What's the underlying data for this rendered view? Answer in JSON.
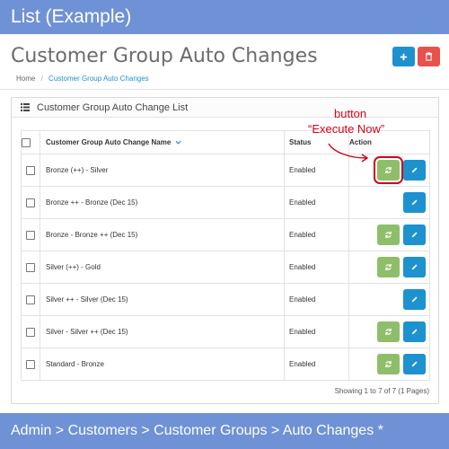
{
  "banner": {
    "top": "List (Example)",
    "bottom": "Admin > Customers > Customer Groups > Auto Changes *"
  },
  "page": {
    "title": "Customer Group Auto Changes"
  },
  "breadcrumb": {
    "home": "Home",
    "separator": "/",
    "current": "Customer Group Auto Changes"
  },
  "panel": {
    "title": "Customer Group Auto Change List"
  },
  "table": {
    "headers": {
      "name": "Customer Group Auto Change Name",
      "status": "Status",
      "action": "Action"
    },
    "rows": [
      {
        "name": "Bronze (++) - Silver",
        "status": "Enabled",
        "execute": true
      },
      {
        "name": "Bronze ++ - Bronze (Dec 15)",
        "status": "Enabled",
        "execute": false
      },
      {
        "name": "Bronze - Bronze ++ (Dec 15)",
        "status": "Enabled",
        "execute": true
      },
      {
        "name": "Silver (++) - Gold",
        "status": "Enabled",
        "execute": true
      },
      {
        "name": "Silver ++ - Silver (Dec 15)",
        "status": "Enabled",
        "execute": false
      },
      {
        "name": "Silver - Silver ++ (Dec 15)",
        "status": "Enabled",
        "execute": true
      },
      {
        "name": "Standard - Bronze",
        "status": "Enabled",
        "execute": true
      }
    ]
  },
  "pagination": {
    "text": "Showing 1 to 7 of 7 (1 Pages)"
  },
  "annotation": {
    "line1": "button",
    "line2": "“Execute Now”"
  },
  "colors": {
    "banner": "#6f92d6",
    "primary": "#1e91cf",
    "danger": "#e8514c",
    "success": "#8fbe6a",
    "annotation": "#d0021b"
  },
  "icons": {
    "add": "plus-icon",
    "delete": "trash-icon",
    "list": "list-icon",
    "execute": "refresh-icon",
    "edit": "pencil-icon",
    "sort": "caret-down-icon"
  }
}
